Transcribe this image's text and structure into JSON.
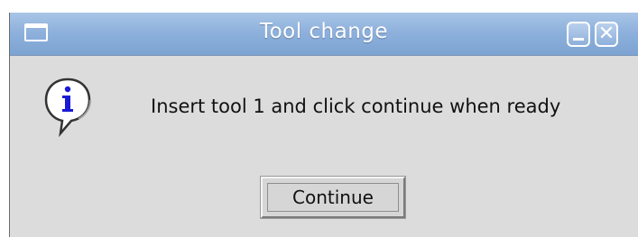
{
  "window": {
    "title": "Tool change"
  },
  "dialog": {
    "message": "Insert tool 1 and click continue when ready",
    "icon": "info-icon",
    "continue_label": "Continue"
  },
  "titlebar_buttons": {
    "menu_icon": "window-menu-icon",
    "minimize_icon": "minimize-icon",
    "close_glyph": "✕"
  },
  "colors": {
    "titlebar": "#8eb1dc",
    "dialog_bg": "#dcdcdc",
    "info_blue": "#1a1ad6"
  }
}
